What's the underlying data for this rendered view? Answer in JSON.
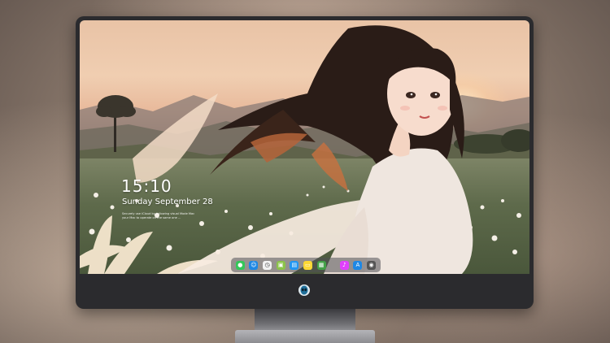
{
  "lockscreen": {
    "time": "15:10",
    "date": "Sunday September 28",
    "fine_print_line1": "Securely use iCloud by following visual Mode Mac",
    "fine_print_line2": "your Mac to operate on the same one ..."
  },
  "dock": {
    "items": [
      {
        "name": "messages-icon",
        "color": "#34c759",
        "glyph": "●"
      },
      {
        "name": "finder-icon",
        "color": "#1e88e5",
        "glyph": "☺"
      },
      {
        "name": "clock-app-icon",
        "color": "#f2f2f2",
        "glyph": "◷"
      },
      {
        "name": "preview-icon",
        "color": "#8bc34a",
        "glyph": "▣"
      },
      {
        "name": "clapper-icon",
        "color": "#2196f3",
        "glyph": "▤"
      },
      {
        "name": "notes-icon",
        "color": "#fdd835",
        "glyph": "▭"
      },
      {
        "name": "numbers-icon",
        "color": "#43a047",
        "glyph": "▦"
      },
      {
        "name": "music-icon",
        "color": "#e040fb",
        "glyph": "♪"
      },
      {
        "name": "app-store-icon",
        "color": "#1e88e5",
        "glyph": "A"
      },
      {
        "name": "screenshot-icon",
        "color": "#555555",
        "glyph": "◉"
      }
    ]
  },
  "colors": {
    "bezel": "#2b2b2e",
    "text": "#ffffff"
  }
}
